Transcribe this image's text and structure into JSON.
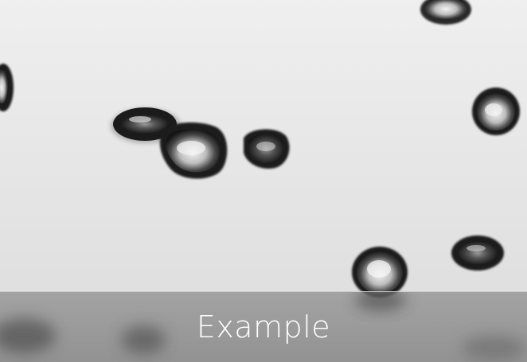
{
  "caption": {
    "text": "Example"
  },
  "image": {
    "subject": "droplets"
  }
}
